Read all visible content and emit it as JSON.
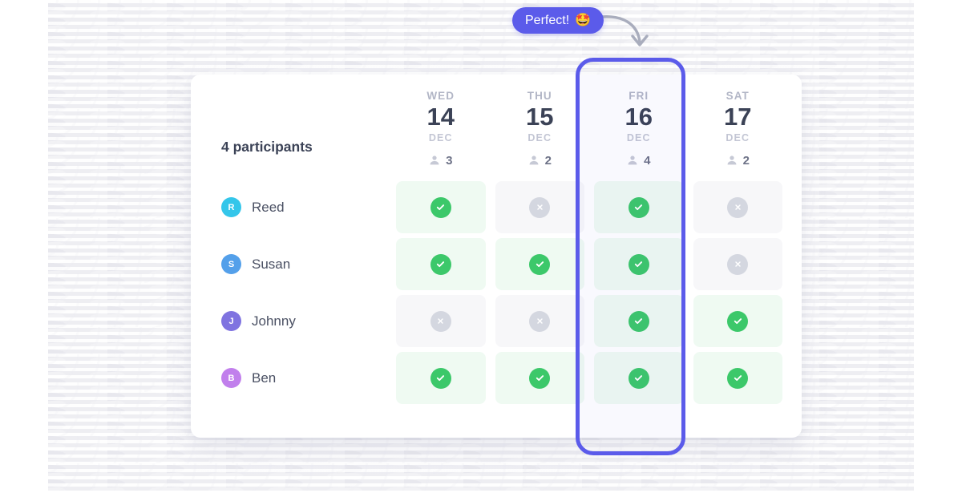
{
  "callout": {
    "text": "Perfect!",
    "emoji": "🤩",
    "pill_color": "#5b5bea",
    "arrow_icon": "curved-arrow-icon"
  },
  "card": {
    "participants_label": "4 participants",
    "highlight_color": "#5b5bea",
    "highlighted_day_index": 2
  },
  "days": [
    {
      "dow": "WED",
      "num": "14",
      "month": "DEC",
      "count": "3",
      "highlighted": false
    },
    {
      "dow": "THU",
      "num": "15",
      "month": "DEC",
      "count": "2",
      "highlighted": false
    },
    {
      "dow": "FRI",
      "num": "16",
      "month": "DEC",
      "count": "4",
      "highlighted": true
    },
    {
      "dow": "SAT",
      "num": "17",
      "month": "DEC",
      "count": "2",
      "highlighted": false
    }
  ],
  "participants": [
    {
      "initial": "R",
      "name": "Reed",
      "color": "#2ec5ea",
      "availability": [
        "yes",
        "no",
        "yes",
        "no"
      ]
    },
    {
      "initial": "S",
      "name": "Susan",
      "color": "#4f9dea",
      "availability": [
        "yes",
        "yes",
        "yes",
        "no"
      ]
    },
    {
      "initial": "J",
      "name": "Johnny",
      "color": "#7b6fe0",
      "availability": [
        "no",
        "no",
        "yes",
        "yes"
      ]
    },
    {
      "initial": "B",
      "name": "Ben",
      "color": "#c07bec",
      "availability": [
        "yes",
        "yes",
        "yes",
        "yes"
      ]
    }
  ],
  "icons": {
    "person": "person-icon",
    "available": "check-circle-icon",
    "unavailable": "cross-circle-icon"
  },
  "colors": {
    "available": "#3cc86a",
    "available_cell": "#effaf2",
    "unavailable": "#d4d7e0",
    "unavailable_cell": "#f7f7f9"
  }
}
